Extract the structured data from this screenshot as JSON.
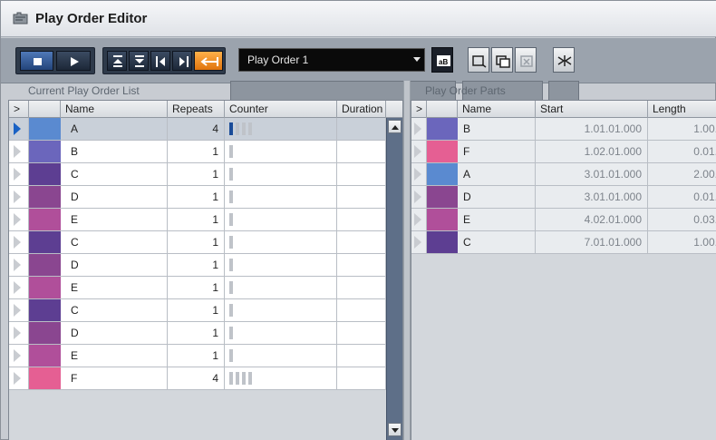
{
  "window": {
    "title": "Play Order Editor",
    "icon": "play-order-icon"
  },
  "toolbar": {
    "stop_icon": "stop-icon",
    "play_icon": "play-icon",
    "move_up_icon": "move-to-top-icon",
    "move_down_icon": "move-to-bottom-icon",
    "move_left_icon": "move-left-icon",
    "move_right_icon": "move-right-icon",
    "insert_icon": "insert-left-icon",
    "play_order_select": "Play Order 1",
    "rename_icon": "rename-icon",
    "duplicate_icon": "duplicate-icon",
    "copy_icon": "copy-icon",
    "delete_icon": "delete-icon",
    "flatten_icon": "flatten-icon"
  },
  "left": {
    "label": "Current Play Order List",
    "columns": [
      ">",
      "Name",
      "Repeats",
      "Counter",
      "Duration"
    ],
    "rows": [
      {
        "name": "A",
        "repeats": "4",
        "color": "#5a8ad0",
        "counter_total": 4,
        "counter_on": 1,
        "active": true
      },
      {
        "name": "B",
        "repeats": "1",
        "color": "#6b66bc",
        "counter_total": 1,
        "counter_on": 0,
        "active": false
      },
      {
        "name": "C",
        "repeats": "1",
        "color": "#5d3e92",
        "counter_total": 1,
        "counter_on": 0,
        "active": false
      },
      {
        "name": "D",
        "repeats": "1",
        "color": "#8a4690",
        "counter_total": 1,
        "counter_on": 0,
        "active": false
      },
      {
        "name": "E",
        "repeats": "1",
        "color": "#b04f9a",
        "counter_total": 1,
        "counter_on": 0,
        "active": false
      },
      {
        "name": "C",
        "repeats": "1",
        "color": "#5d3e92",
        "counter_total": 1,
        "counter_on": 0,
        "active": false
      },
      {
        "name": "D",
        "repeats": "1",
        "color": "#8a4690",
        "counter_total": 1,
        "counter_on": 0,
        "active": false
      },
      {
        "name": "E",
        "repeats": "1",
        "color": "#b04f9a",
        "counter_total": 1,
        "counter_on": 0,
        "active": false
      },
      {
        "name": "C",
        "repeats": "1",
        "color": "#5d3e92",
        "counter_total": 1,
        "counter_on": 0,
        "active": false
      },
      {
        "name": "D",
        "repeats": "1",
        "color": "#8a4690",
        "counter_total": 1,
        "counter_on": 0,
        "active": false
      },
      {
        "name": "E",
        "repeats": "1",
        "color": "#b04f9a",
        "counter_total": 1,
        "counter_on": 0,
        "active": false
      },
      {
        "name": "F",
        "repeats": "4",
        "color": "#e55f93",
        "counter_total": 4,
        "counter_on": 0,
        "active": false
      }
    ]
  },
  "right": {
    "label": "Play Order Parts",
    "columns": [
      ">",
      "Name",
      "Start",
      "Length"
    ],
    "rows": [
      {
        "name": "B",
        "start": "1.01.01.000",
        "length": "1.00.",
        "color": "#6b66bc"
      },
      {
        "name": "F",
        "start": "1.02.01.000",
        "length": "0.01.",
        "color": "#e55f93"
      },
      {
        "name": "A",
        "start": "3.01.01.000",
        "length": "2.00.",
        "color": "#5a8ad0"
      },
      {
        "name": "D",
        "start": "3.01.01.000",
        "length": "0.01.",
        "color": "#8a4690"
      },
      {
        "name": "E",
        "start": "4.02.01.000",
        "length": "0.03.",
        "color": "#b04f9a"
      },
      {
        "name": "C",
        "start": "7.01.01.000",
        "length": "1.00.",
        "color": "#5d3e92"
      }
    ]
  }
}
